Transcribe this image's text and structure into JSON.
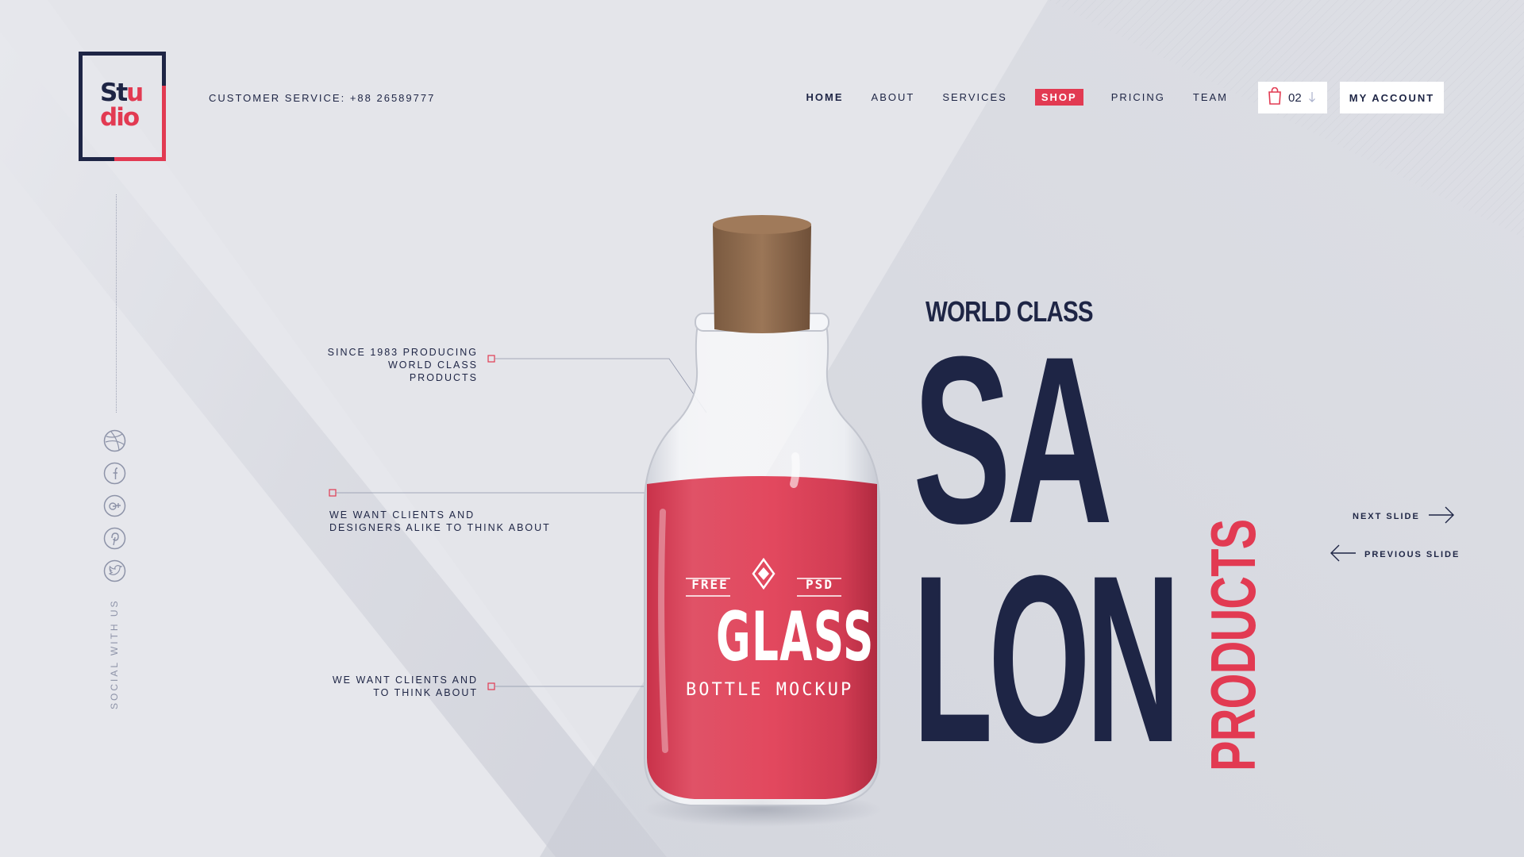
{
  "logo": {
    "line1_a": "St",
    "line1_b": "u",
    "line2": "dio"
  },
  "header": {
    "customer_service": "CUSTOMER SERVICE: +88 26589777",
    "nav": [
      {
        "label": "HOME"
      },
      {
        "label": "ABOUT"
      },
      {
        "label": "SERVICES"
      },
      {
        "label": "SHOP"
      },
      {
        "label": "PRICING"
      },
      {
        "label": "TEAM"
      }
    ],
    "cart_count": "02",
    "account_label": "MY ACCOUNT"
  },
  "social": {
    "label": "SOCIAL WITH US",
    "icons": [
      "dribbble-icon",
      "facebook-icon",
      "google-plus-icon",
      "pinterest-icon",
      "twitter-icon"
    ]
  },
  "callouts": [
    {
      "line1": "SINCE 1983 PRODUCING",
      "line2": "WORLD CLASS PRODUCTS"
    },
    {
      "line1": "WE WANT CLIENTS AND",
      "line2": "DESIGNERS ALIKE TO THINK ABOUT"
    },
    {
      "line1": "WE WANT CLIENTS AND",
      "line2": "TO THINK ABOUT"
    }
  ],
  "bottle_label": {
    "free": "FREE",
    "psd": "PSD",
    "title": "GLASS",
    "subtitle": "BOTTLE MOCKUP"
  },
  "hero": {
    "kicker": "WORLD CLASS",
    "line1": "SA",
    "line2": "LON",
    "vertical": "PRODUCTS"
  },
  "slider": {
    "next": "NEXT SLIDE",
    "previous": "PREVIOUS SLIDE"
  },
  "colors": {
    "navy": "#1e2545",
    "accent": "#e23a52",
    "background": "#e3e4e9"
  }
}
